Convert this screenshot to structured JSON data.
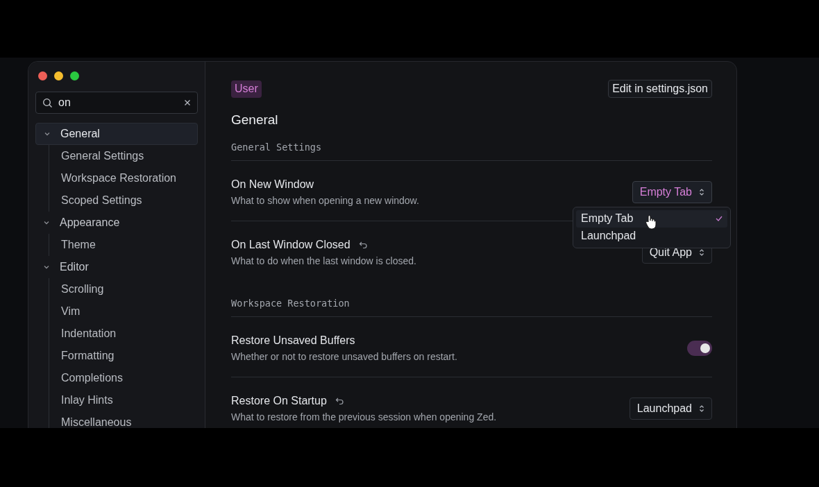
{
  "search": {
    "value": "on"
  },
  "sidebar": {
    "items": [
      {
        "label": "General",
        "expanded": true,
        "selected": true,
        "children": [
          {
            "label": "General Settings",
            "selected": false
          },
          {
            "label": "Workspace Restoration",
            "selected": false
          },
          {
            "label": "Scoped Settings",
            "selected": false
          }
        ]
      },
      {
        "label": "Appearance",
        "expanded": true,
        "selected": false,
        "children": [
          {
            "label": "Theme",
            "selected": false
          }
        ]
      },
      {
        "label": "Editor",
        "expanded": true,
        "selected": false,
        "children": [
          {
            "label": "Scrolling",
            "selected": false
          },
          {
            "label": "Vim",
            "selected": false
          },
          {
            "label": "Indentation",
            "selected": false
          },
          {
            "label": "Formatting",
            "selected": false
          },
          {
            "label": "Completions",
            "selected": false
          },
          {
            "label": "Inlay Hints",
            "selected": false
          },
          {
            "label": "Miscellaneous",
            "selected": false
          }
        ]
      }
    ]
  },
  "scope_badge": "User",
  "edit_button": "Edit in settings.json",
  "page_title": "General",
  "sections": [
    {
      "title": "General Settings",
      "items": [
        {
          "kind": "select",
          "title": "On New Window",
          "description": "What to show when opening a new window.",
          "resettable": false,
          "value": "Empty Tab",
          "modified": true,
          "open": true
        },
        {
          "kind": "select",
          "title": "On Last Window Closed",
          "description": "What to do when the last window is closed.",
          "resettable": true,
          "value": "Quit App",
          "modified": false,
          "open": false
        }
      ]
    },
    {
      "title": "Workspace Restoration",
      "items": [
        {
          "kind": "toggle",
          "title": "Restore Unsaved Buffers",
          "description": "Whether or not to restore unsaved buffers on restart.",
          "resettable": false,
          "on": true
        },
        {
          "kind": "select",
          "title": "Restore On Startup",
          "description": "What to restore from the previous session when opening Zed.",
          "resettable": true,
          "value": "Launchpad",
          "modified": false,
          "open": false
        }
      ]
    }
  ],
  "dropdown": {
    "options": [
      {
        "label": "Empty Tab",
        "selected": true
      },
      {
        "label": "Launchpad",
        "selected": false
      }
    ]
  }
}
